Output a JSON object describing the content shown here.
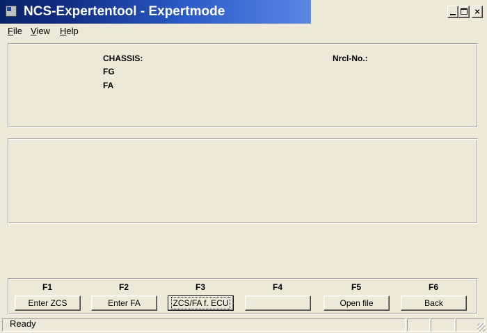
{
  "window": {
    "title": "NCS-Expertentool - Expertmode",
    "icon": "app-icon"
  },
  "controls": {
    "minimize": "minimize-icon",
    "maximize": "maximize-icon",
    "close_glyph": "×"
  },
  "menu": {
    "file": {
      "accel": "F",
      "rest": "ile"
    },
    "view": {
      "accel": "V",
      "rest": "iew"
    },
    "help": {
      "accel": "H",
      "rest": "elp"
    }
  },
  "info": {
    "chassis_label": "CHASSIS:",
    "fg_label": "FG",
    "fa_label": "FA",
    "nrcl_label": "Nrcl-No.:"
  },
  "fkeys": [
    {
      "key": "F1",
      "label": "Enter ZCS"
    },
    {
      "key": "F2",
      "label": "Enter FA"
    },
    {
      "key": "F3",
      "label": "ZCS/FA f. ECU"
    },
    {
      "key": "F4",
      "label": ""
    },
    {
      "key": "F5",
      "label": "Open file"
    },
    {
      "key": "F6",
      "label": "Back"
    }
  ],
  "status": {
    "text": "Ready"
  }
}
